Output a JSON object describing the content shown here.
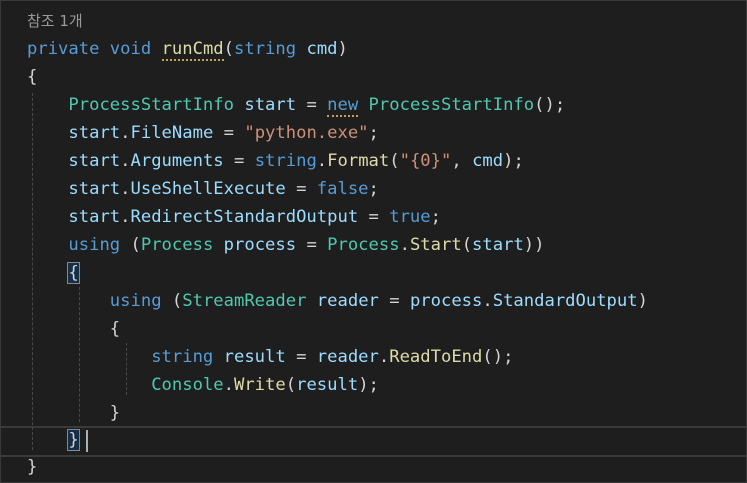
{
  "editor": {
    "codelens": "참조 1개",
    "tokens": {
      "private": "private",
      "void": "void",
      "runCmd": "runCmd",
      "string": "string",
      "cmd": "cmd",
      "ProcessStartInfo": "ProcessStartInfo",
      "start": "start",
      "new": "new",
      "FileName": "FileName",
      "python_exe": "\"python.exe\"",
      "Arguments": "Arguments",
      "Format": "Format",
      "fmt": "\"{0}\"",
      "UseShellExecute": "UseShellExecute",
      "false": "false",
      "RedirectStandardOutput": "RedirectStandardOutput",
      "true": "true",
      "using": "using",
      "Process": "Process",
      "process": "process",
      "Start": "Start",
      "StreamReader": "StreamReader",
      "reader": "reader",
      "StandardOutput": "StandardOutput",
      "result": "result",
      "ReadToEnd": "ReadToEnd",
      "Console": "Console",
      "Write": "Write"
    }
  },
  "colors": {
    "background": "#1e1e1e",
    "keyword": "#569cd6",
    "type": "#4ec9b0",
    "function": "#dcdcaa",
    "string": "#ce9178",
    "variable": "#9cdcfe",
    "plain": "#d4d4d4"
  }
}
